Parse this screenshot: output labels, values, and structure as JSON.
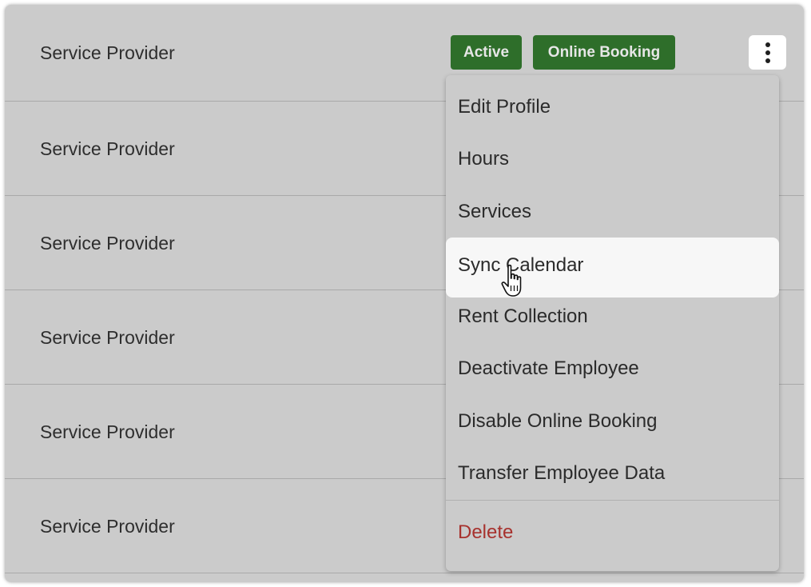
{
  "rows": [
    {
      "label": "Service Provider"
    },
    {
      "label": "Service Provider"
    },
    {
      "label": "Service Provider"
    },
    {
      "label": "Service Provider"
    },
    {
      "label": "Service Provider"
    },
    {
      "label": "Service Provider"
    }
  ],
  "badges": {
    "active": "Active",
    "online_booking": "Online Booking"
  },
  "menu": {
    "items": [
      {
        "label": "Edit Profile"
      },
      {
        "label": "Hours"
      },
      {
        "label": "Services"
      },
      {
        "label": "Sync Calendar",
        "hovered": true
      },
      {
        "label": "Rent Collection"
      },
      {
        "label": "Deactivate Employee"
      },
      {
        "label": "Disable Online Booking"
      },
      {
        "label": "Transfer Employee Data"
      }
    ],
    "delete_label": "Delete"
  },
  "icons": {
    "kebab": "more-vertical-icon",
    "cursor": "hand-pointer-icon"
  },
  "colors": {
    "badge_green": "#2e6e2a",
    "delete_red": "#a7322e",
    "background": "#cbcbcb",
    "hover_row": "#f7f7f7"
  }
}
